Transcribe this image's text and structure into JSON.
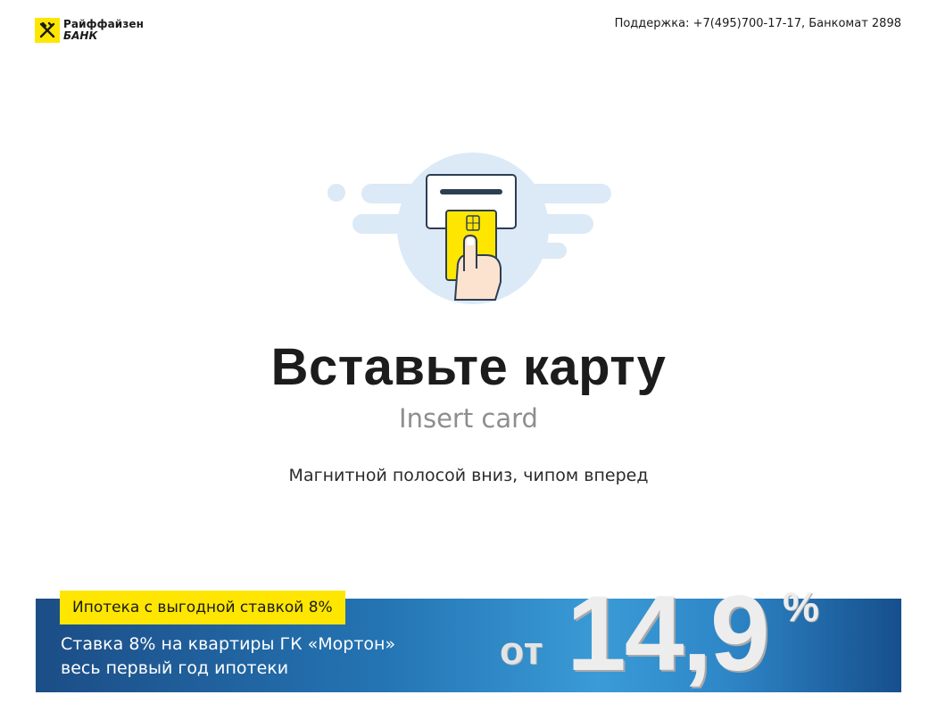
{
  "header": {
    "logo": {
      "line1": "Райффайзен",
      "line2": "БАНК",
      "brand_color": "#fee600"
    },
    "support_text": "Поддержка: +7(495)700-17-17, Банкомат 2898"
  },
  "main": {
    "illustration_icon": "insert-card-icon",
    "title": "Вставьте карту",
    "subtitle": "Insert card",
    "hint": "Магнитной полосой вниз, чипом вперед"
  },
  "banner": {
    "badge": "Ипотека с выгодной ставкой 8%",
    "line1": "Ставка 8% на квартиры ГК «Мортон»",
    "line2": "весь первый год ипотеки",
    "promo_prefix": "от",
    "promo_value": "14,9",
    "promo_percent": "%",
    "colors": {
      "badge": "#fee600",
      "banner_dark": "#1c4d86",
      "banner_light": "#3a9bd6"
    }
  }
}
